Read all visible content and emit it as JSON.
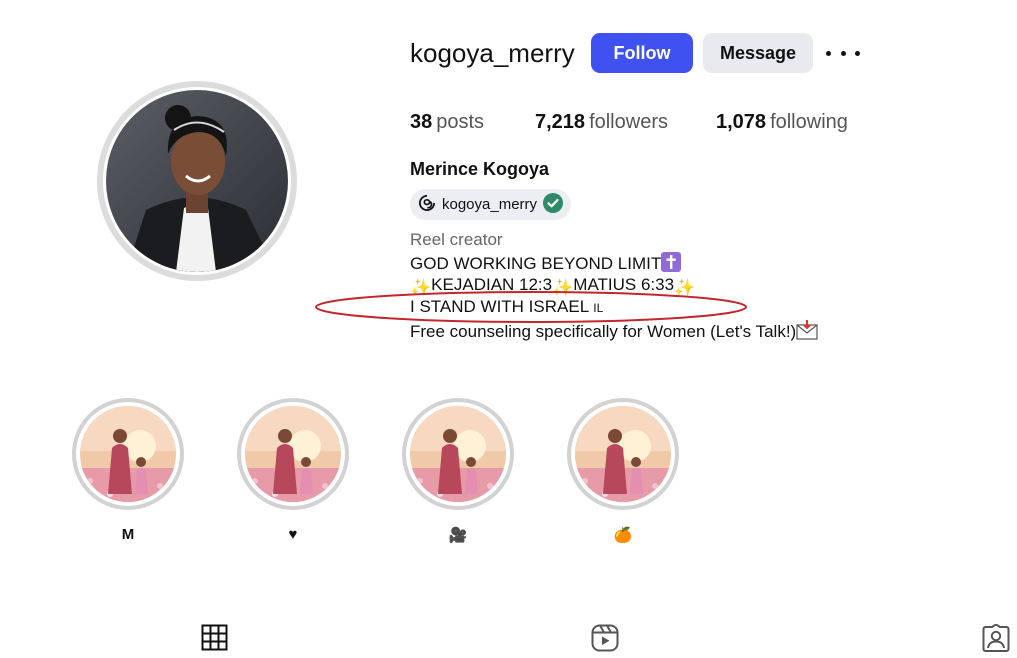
{
  "profile": {
    "username": "kogoya_merry",
    "follow_label": "Follow",
    "message_label": "Message",
    "more_icon": "more-options-icon",
    "full_name": "Merince Kogoya"
  },
  "stats": {
    "posts_count": "38",
    "posts_label": "posts",
    "followers_count": "7,218",
    "followers_label": "followers",
    "following_count": "1,078",
    "following_label": "following"
  },
  "threads": {
    "handle": "kogoya_merry",
    "icon": "threads-icon",
    "verified_icon": "verified-check-icon"
  },
  "bio": {
    "category": "Reel creator",
    "line1": "GOD WORKING BEYOND LIMIT",
    "line1_emoji": "latin-cross-emoji",
    "line2_parts": [
      "KEJADIAN 12:3",
      "MATIUS 6:33"
    ],
    "line2_emoji": "sparkles-emoji",
    "line3": "I STAND WITH ISRAEL",
    "line3_suffix": "IL",
    "line4": "Free counseling specifically for Women (Let's Talk!)",
    "line4_emoji": "envelope-with-arrow-emoji"
  },
  "annotation": {
    "color": "#c0282d",
    "shape": "ellipse"
  },
  "highlights": [
    {
      "label": "M"
    },
    {
      "label": "♥"
    },
    {
      "label": "🎥"
    },
    {
      "label": "🍊"
    }
  ],
  "tabs": [
    {
      "icon": "grid-posts-icon"
    },
    {
      "icon": "reels-icon"
    },
    {
      "icon": "tagged-icon"
    }
  ],
  "colors": {
    "follow_button": "#4051f2",
    "message_button": "#e9eaee",
    "verified_badge": "#2e8b6a"
  }
}
